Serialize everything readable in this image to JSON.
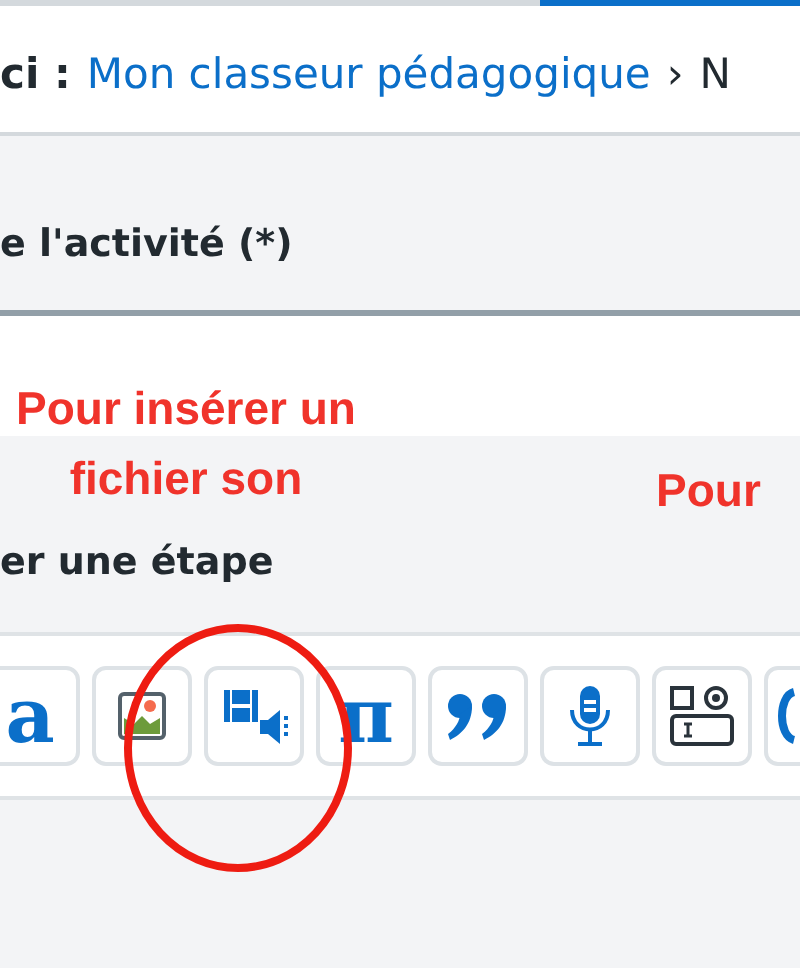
{
  "breadcrumb": {
    "prefix": "ci :",
    "link": "Mon classeur pédagogique",
    "separator": "›",
    "next": "N"
  },
  "field": {
    "label": "e l'activité (*)"
  },
  "section": {
    "label": "er une étape"
  },
  "toolbar": [
    {
      "kind": "text",
      "glyph": "a"
    },
    {
      "kind": "image"
    },
    {
      "kind": "media"
    },
    {
      "kind": "text",
      "glyph": "π"
    },
    {
      "kind": "quote"
    },
    {
      "kind": "mic"
    },
    {
      "kind": "form"
    },
    {
      "kind": "cut"
    }
  ],
  "annotations": [
    {
      "text": "Pour insérer un\nfichier son",
      "kind": "note"
    },
    {
      "text": "Pour",
      "kind": "note-right"
    }
  ]
}
